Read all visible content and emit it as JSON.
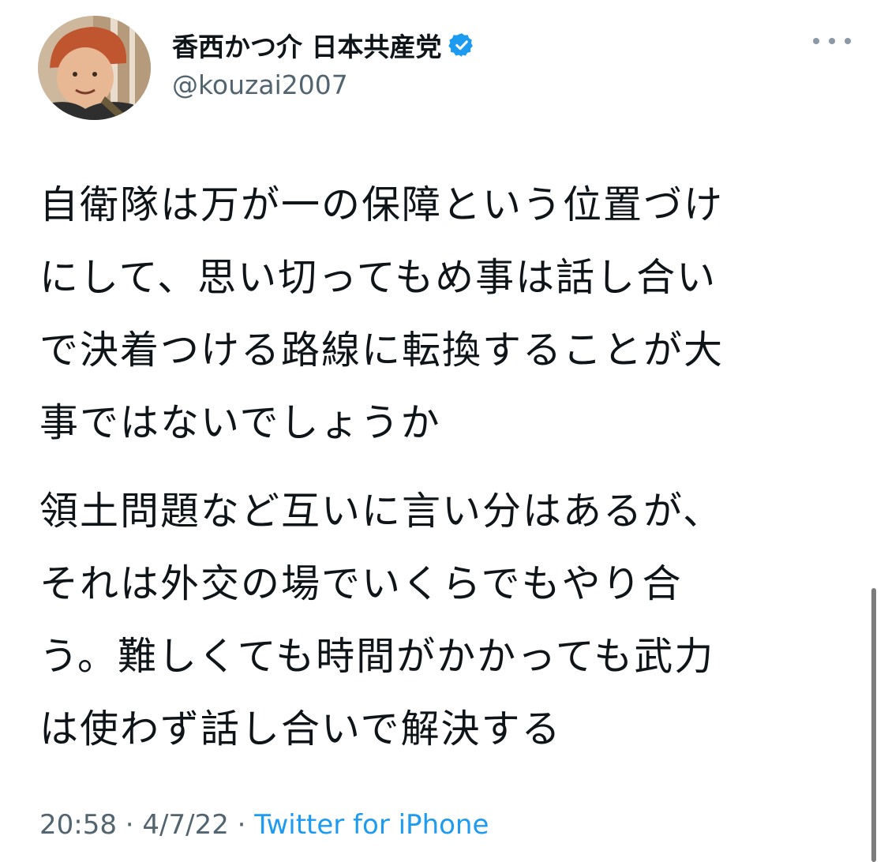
{
  "tweet": {
    "author": {
      "display_name": "香西かつ介 日本共産党",
      "handle": "@kouzai2007",
      "verified": true
    },
    "paragraphs": [
      {
        "lines": [
          "自衛隊は万が一の保障という位置づけ",
          "にして、思い切ってもめ事は話し合い",
          "で決着つける路線に転換することが大",
          "事ではないでしょうか"
        ]
      },
      {
        "lines": [
          "領土問題など互いに言い分はあるが、",
          "それは外交の場でいくらでもやり合",
          "う。難しくても時間がかかっても武力",
          "は使わず話し合いで解決する"
        ]
      }
    ],
    "time": "20:58",
    "date": "4/7/22",
    "separator": "·",
    "source": "Twitter for iPhone"
  },
  "icons": {
    "verified": "verified-badge-icon",
    "more": "more-options-icon"
  },
  "colors": {
    "text": "#0f1419",
    "secondary": "#536471",
    "link": "#1d9bf0",
    "verified": "#1d9bf0"
  }
}
